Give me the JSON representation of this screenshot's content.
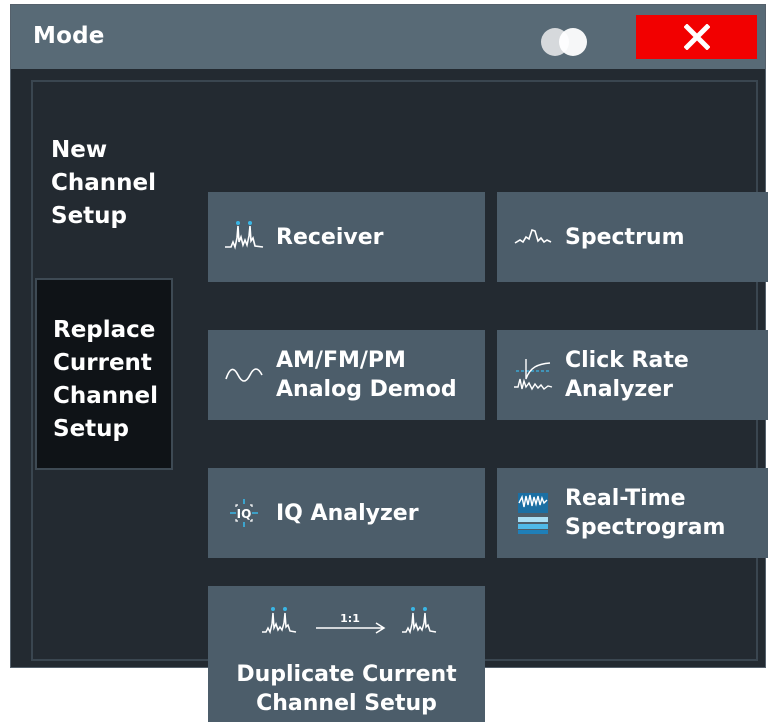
{
  "dialog": {
    "title": "Mode"
  },
  "tabs": {
    "new": "New Channel Setup",
    "replace": "Replace Current Channel Setup"
  },
  "buttons": {
    "receiver": "Receiver",
    "spectrum": "Spectrum",
    "am_fm_pm": "AM/FM/PM Analog Demod",
    "click_rate": "Click Rate Analyzer",
    "iq": "IQ Analyzer",
    "realtime": "Real-Time Spectrogram",
    "duplicate": "Duplicate Current Channel Setup",
    "duplicate_ratio": "1:1"
  },
  "icons": {
    "close": "close-icon",
    "toggle": "display-toggle-icon",
    "receiver": "receiver-icon",
    "spectrum": "spectrum-icon",
    "am_fm_pm": "analog-demod-icon",
    "click_rate": "click-rate-icon",
    "iq": "iq-analyzer-icon",
    "realtime": "realtime-spectrogram-icon",
    "duplicate": "duplicate-icon"
  },
  "colors": {
    "titlebar": "#586a76",
    "background": "#232a31",
    "button": "#4c5d6a",
    "close": "#f20000",
    "active_tab": "#0f1317",
    "accent": "#39b6e6"
  }
}
